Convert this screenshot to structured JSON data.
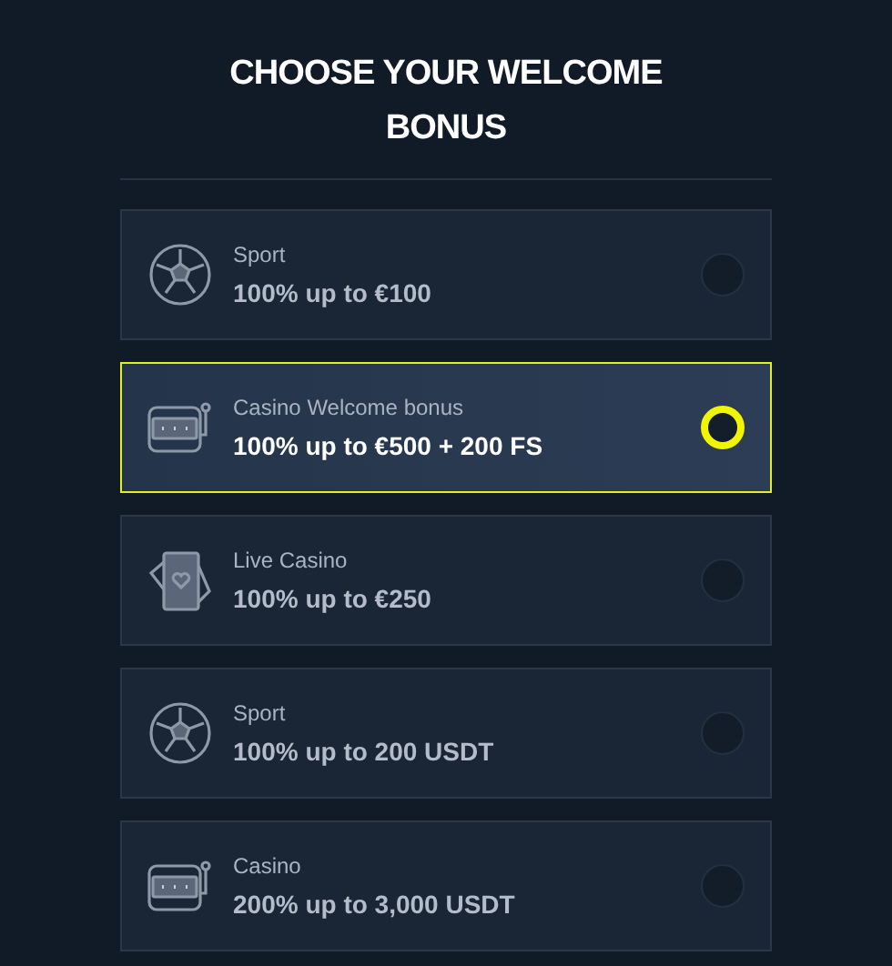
{
  "title": "CHOOSE YOUR WELCOME BONUS",
  "bonuses": [
    {
      "kind": "ball",
      "category": "Sport",
      "offer": "100% up to €100",
      "selected": false
    },
    {
      "kind": "slot",
      "category": "Casino Welcome bonus",
      "offer": "100% up to €500 + 200 FS",
      "selected": true
    },
    {
      "kind": "cards",
      "category": "Live Casino",
      "offer": "100% up to €250",
      "selected": false
    },
    {
      "kind": "ball",
      "category": "Sport",
      "offer": "100% up to 200 USDT",
      "selected": false
    },
    {
      "kind": "slot",
      "category": "Casino",
      "offer": "200% up to 3,000 USDT",
      "selected": false
    }
  ]
}
